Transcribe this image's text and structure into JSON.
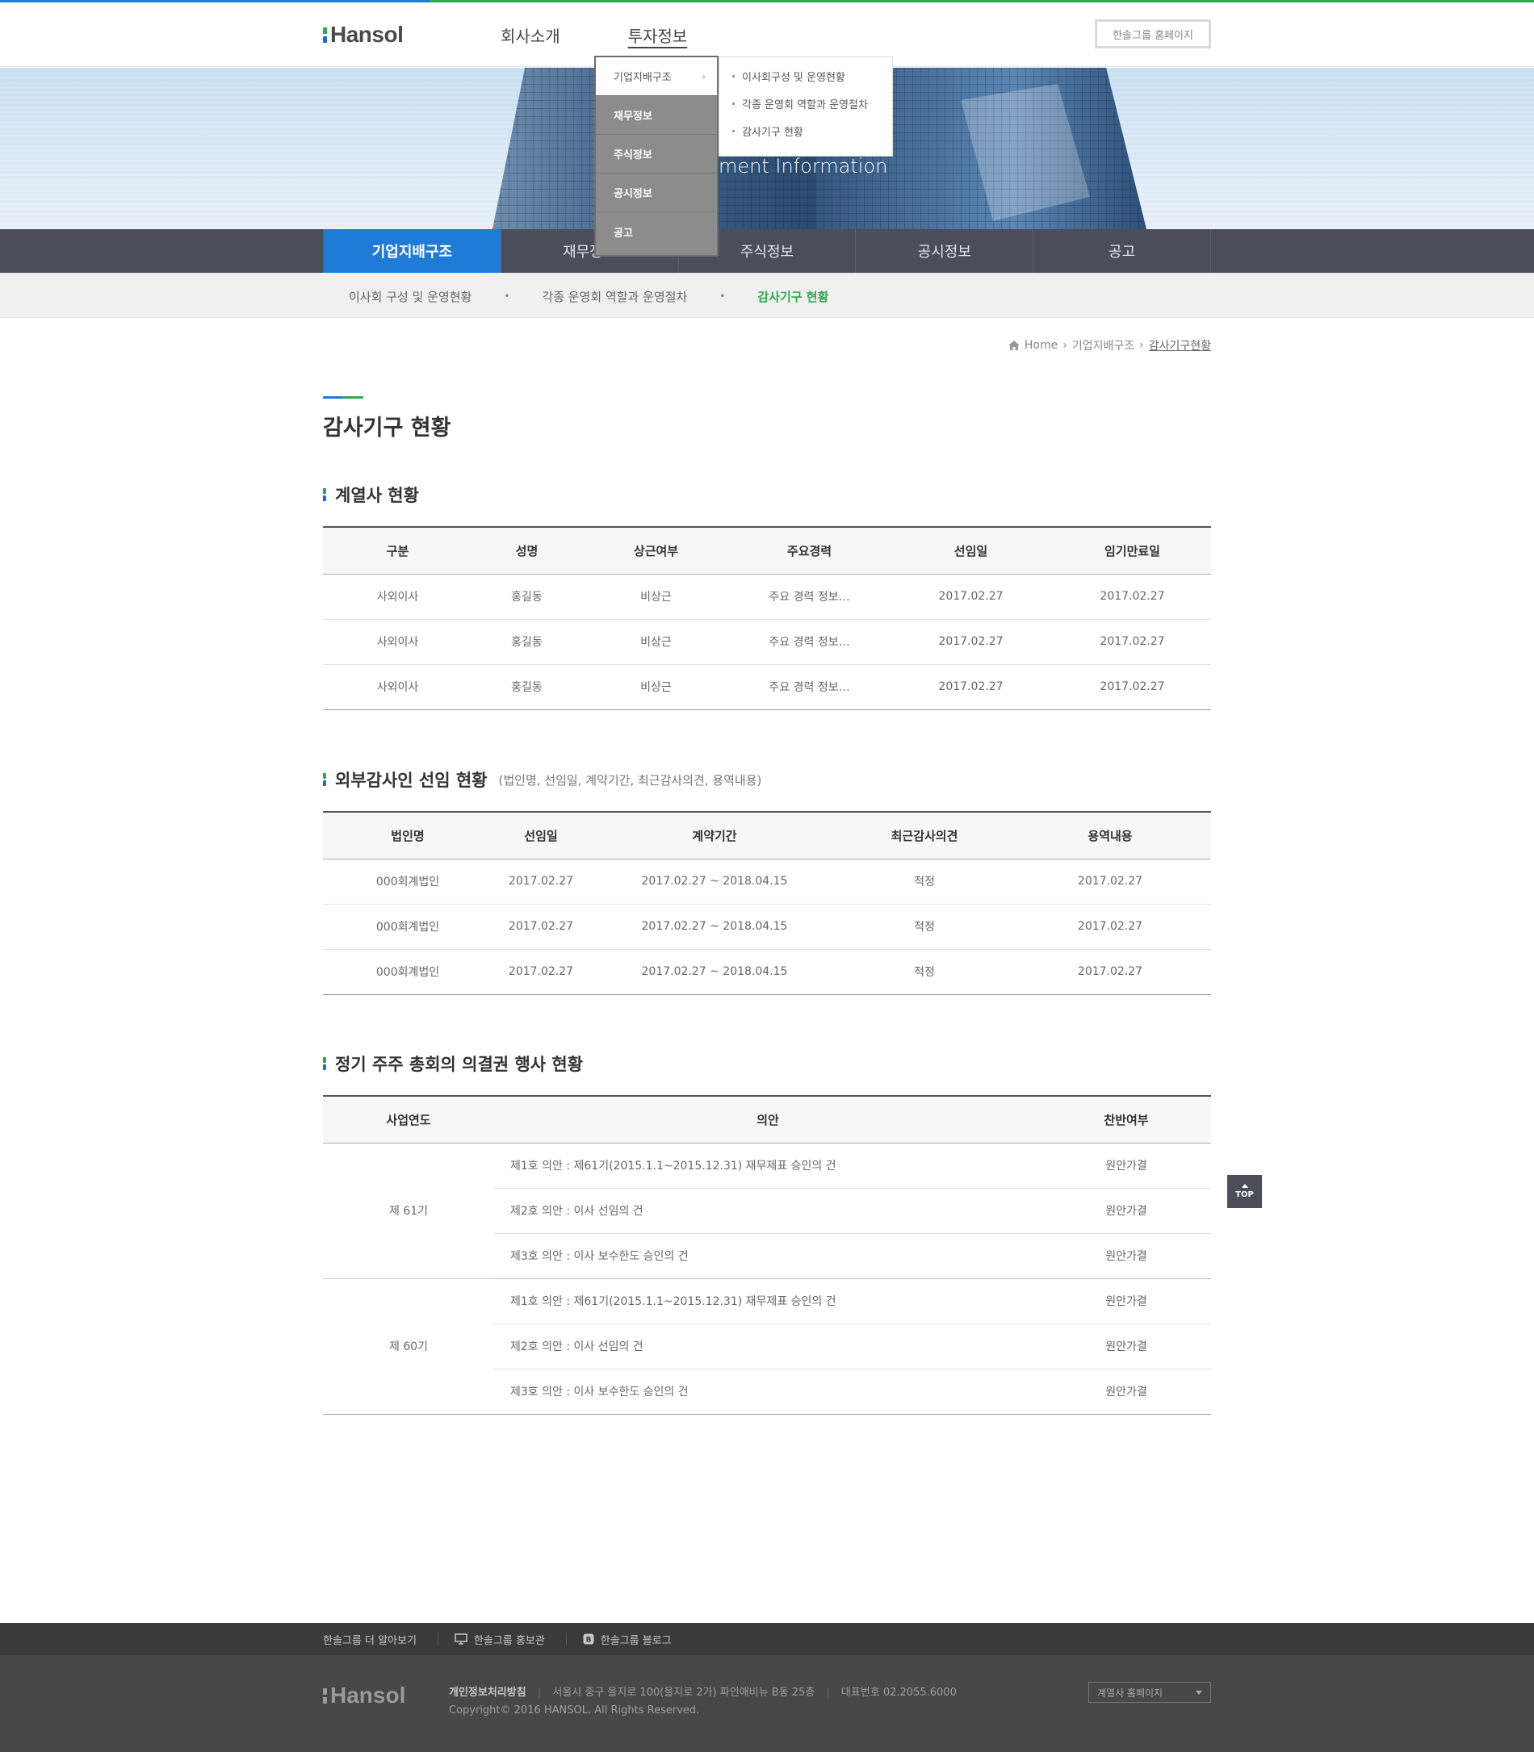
{
  "header": {
    "logo": "Hansol",
    "nav": [
      "회사소개",
      "투자정보"
    ],
    "family_button": "한솔그룹 홈페이지"
  },
  "hero": {
    "text": "ment Information"
  },
  "dropdown": {
    "items": [
      "기업지배구조",
      "재무정보",
      "주식정보",
      "공시정보",
      "공고"
    ],
    "sub_items": [
      "이사회구성 및 운영현황",
      "각종 운영회 역할과 운영절차",
      "감사기구 현황"
    ]
  },
  "lnb": {
    "items": [
      "기업지배구조",
      "재무정보",
      "주식정보",
      "공시정보",
      "공고"
    ]
  },
  "snb": {
    "items": [
      "이사회 구성 및 운영현황",
      "각종 운영회 역할과 운영절차",
      "감사기구 현황"
    ]
  },
  "breadcrumb": {
    "home": "Home",
    "level1": "기업지배구조",
    "current": "감사기구현황"
  },
  "page_title": "감사기구 현황",
  "section1": {
    "title": "계열사 현황",
    "headers": [
      "구분",
      "성명",
      "상근여부",
      "주요경력",
      "선임일",
      "임기만료일"
    ],
    "rows": [
      [
        "사외이사",
        "홍길동",
        "비상근",
        "주요 경력 정보…",
        "2017.02.27",
        "2017.02.27"
      ],
      [
        "사외이사",
        "홍길동",
        "비상근",
        "주요 경력 정보…",
        "2017.02.27",
        "2017.02.27"
      ],
      [
        "사외이사",
        "홍길동",
        "비상근",
        "주요 경력 정보…",
        "2017.02.27",
        "2017.02.27"
      ]
    ]
  },
  "section2": {
    "title": "외부감사인 선임 현황",
    "subtitle": "(법인명, 선임일, 계약기간, 최근감사의견, 용역내용)",
    "headers": [
      "법인명",
      "선임일",
      "계약기간",
      "최근감사의견",
      "용역내용"
    ],
    "rows": [
      [
        "000회계법인",
        "2017.02.27",
        "2017.02.27 ~ 2018.04.15",
        "적정",
        "2017.02.27"
      ],
      [
        "000회계법인",
        "2017.02.27",
        "2017.02.27 ~ 2018.04.15",
        "적정",
        "2017.02.27"
      ],
      [
        "000회계법인",
        "2017.02.27",
        "2017.02.27 ~ 2018.04.15",
        "적정",
        "2017.02.27"
      ]
    ]
  },
  "section3": {
    "title": "정기 주주 총회의 의결권 행사 현황",
    "headers": [
      "사업연도",
      "의안",
      "찬반여부"
    ],
    "groups": [
      {
        "term": "제 61기",
        "rows": [
          [
            "제1호 의안 : 제61기(2015.1.1~2015.12.31) 재무제표 승인의 건",
            "원안가결"
          ],
          [
            "제2호 의안 : 이사 선임의 건",
            "원안가결"
          ],
          [
            "제3호 의안 : 이사 보수한도 승인의 건",
            "원안가결"
          ]
        ]
      },
      {
        "term": "제 60기",
        "rows": [
          [
            "제1호 의안 : 제61기(2015.1.1~2015.12.31) 재무제표 승인의 건",
            "원안가결"
          ],
          [
            "제2호 의안 : 이사 선임의 건",
            "원안가결"
          ],
          [
            "제3호 의안 : 이사 보수한도 승인의 건",
            "원안가결"
          ]
        ]
      }
    ]
  },
  "top_button": "TOP",
  "footer": {
    "links": [
      "한솔그룹 더 알아보기",
      "한솔그룹 홍보관",
      "한솔그룹 블로그"
    ],
    "logo": "Hansol",
    "privacy": "개인정보처리방침",
    "address": "서울시 중구 을지로 100(을지로 2가) 파인애비뉴 B동 25층",
    "phone": "대표번호 02.2055.6000",
    "copyright": "Copyright© 2016 HANSOL. All Rights Reserved.",
    "select": "계열사 홈페이지"
  },
  "colors": {
    "blue": "#1f7bd6",
    "green": "#2fa84f",
    "nav_dark": "#4b4d5a"
  }
}
